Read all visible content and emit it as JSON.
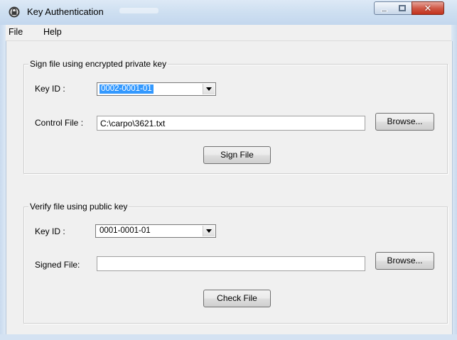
{
  "window": {
    "title": "Key Authentication"
  },
  "menu": {
    "items": [
      {
        "label": "File"
      },
      {
        "label": "Help"
      }
    ]
  },
  "sign_group": {
    "legend": "Sign file using encrypted private key",
    "key_id_label": "Key ID :",
    "key_id_value": "0002-0001-01",
    "control_file_label": "Control File :",
    "control_file_value": "C:\\carpo\\3621.txt",
    "browse_label": "Browse...",
    "action_label": "Sign File"
  },
  "verify_group": {
    "legend": "Verify file using public key",
    "key_id_label": "Key ID :",
    "key_id_value": "0001-0001-01",
    "signed_file_label": "Signed File:",
    "signed_file_value": "",
    "browse_label": "Browse...",
    "action_label": "Check File"
  },
  "colors": {
    "selection": "#3399ff",
    "close_button": "#c9452f",
    "dialog_background": "#f0f0f0"
  },
  "icons": [
    "app-lock-icon",
    "minimize-icon",
    "maximize-icon",
    "close-icon",
    "dropdown-arrow-icon"
  ]
}
